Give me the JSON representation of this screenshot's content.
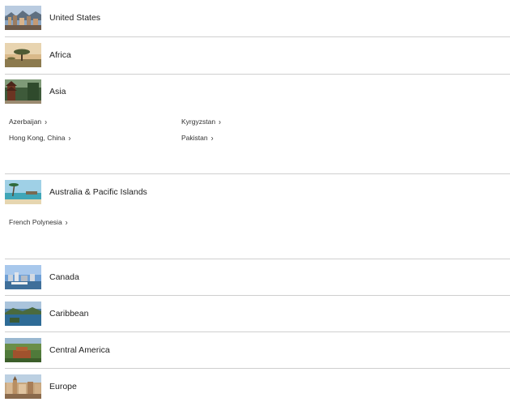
{
  "regions": [
    {
      "label": "United States",
      "image": "city-skyline-photo"
    },
    {
      "label": "Africa",
      "image": "savanna-tree-photo"
    },
    {
      "label": "Asia",
      "image": "temple-forest-photo",
      "countries": [
        {
          "label": "Azerbaijan"
        },
        {
          "label": "Kyrgyzstan"
        },
        {
          "label": "Hong Kong, China"
        },
        {
          "label": "Pakistan"
        }
      ]
    },
    {
      "label": "Australia & Pacific Islands",
      "image": "beach-palm-photo",
      "countries": [
        {
          "label": "French Polynesia"
        }
      ]
    },
    {
      "label": "Canada",
      "image": "harbor-city-photo"
    },
    {
      "label": "Caribbean",
      "image": "island-coast-photo"
    },
    {
      "label": "Central America",
      "image": "ruins-jungle-photo"
    },
    {
      "label": "Europe",
      "image": "old-town-photo"
    }
  ],
  "icons": {
    "chevron": "chevron-right-icon"
  },
  "colors": {
    "text": "#222222",
    "divider": "#cfcfcf"
  }
}
